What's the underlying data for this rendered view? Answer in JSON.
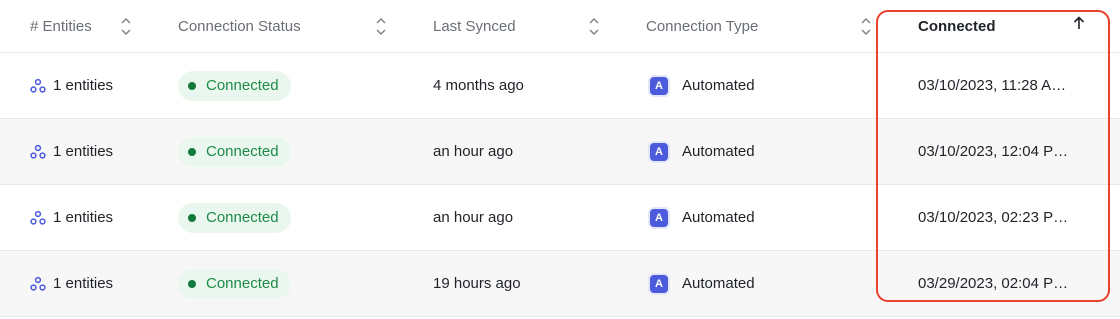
{
  "header": {
    "entities": "# Entities",
    "status": "Connection Status",
    "last_synced": "Last Synced",
    "type": "Connection Type",
    "connected": "Connected"
  },
  "icons": {
    "entities": "entities-icon",
    "sort": "sort-both-icon",
    "sort_asc": "arrow-up-icon",
    "type": "automated-type-icon"
  },
  "colors": {
    "accent": "#4b5bdc",
    "status_bg": "#eaf7ee",
    "status_text": "#1e8a48",
    "highlight": "#e8412c"
  },
  "rows": [
    {
      "entities": "1 entities",
      "status": "Connected",
      "last_synced": "4 months ago",
      "type_badge": "A",
      "type": "Automated",
      "connected": "03/10/2023, 11:28 A…"
    },
    {
      "entities": "1 entities",
      "status": "Connected",
      "last_synced": "an hour ago",
      "type_badge": "A",
      "type": "Automated",
      "connected": "03/10/2023, 12:04 P…"
    },
    {
      "entities": "1 entities",
      "status": "Connected",
      "last_synced": "an hour ago",
      "type_badge": "A",
      "type": "Automated",
      "connected": "03/10/2023, 02:23 P…"
    },
    {
      "entities": "1 entities",
      "status": "Connected",
      "last_synced": "19 hours ago",
      "type_badge": "A",
      "type": "Automated",
      "connected": "03/29/2023, 02:04 P…"
    }
  ]
}
